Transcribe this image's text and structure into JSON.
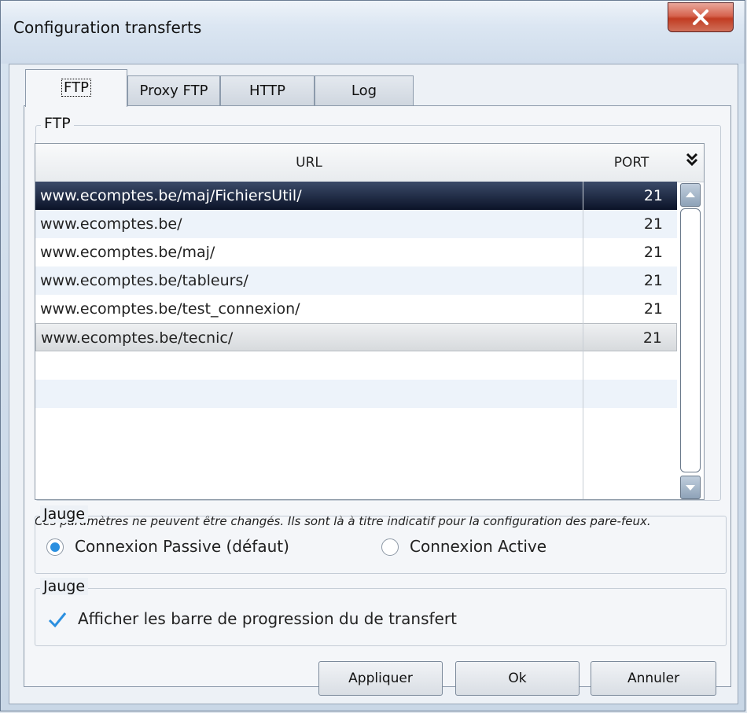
{
  "window": {
    "title": "Configuration transferts"
  },
  "tabs": [
    {
      "label": "FTP",
      "active": true
    },
    {
      "label": "Proxy FTP",
      "active": false
    },
    {
      "label": "HTTP",
      "active": false
    },
    {
      "label": "Log",
      "active": false
    }
  ],
  "ftp_group": {
    "legend": "FTP",
    "columns": {
      "url": "URL",
      "port": "PORT"
    },
    "rows": [
      {
        "url": "www.ecomptes.be/maj/FichiersUtil/",
        "port": "21"
      },
      {
        "url": "www.ecomptes.be/",
        "port": "21"
      },
      {
        "url": "www.ecomptes.be/maj/",
        "port": "21"
      },
      {
        "url": "www.ecomptes.be/tableurs/",
        "port": "21"
      },
      {
        "url": "www.ecomptes.be/test_connexion/",
        "port": "21"
      },
      {
        "url": "www.ecomptes.be/tecnic/",
        "port": "21"
      }
    ],
    "note": "Ces paramètres ne peuvent être changés. Ils sont là à titre indicatif pour la configuration des pare-feux."
  },
  "mode_group": {
    "legend": "Jauge",
    "passive_label": "Connexion Passive (défaut)",
    "active_label": "Connexion Active",
    "selected": "passive"
  },
  "progress_group": {
    "legend": "Jauge",
    "checkbox_label": "Afficher les barre de progression du de transfert",
    "checked": true
  },
  "buttons": {
    "apply": "Appliquer",
    "ok": "Ok",
    "cancel": "Annuler"
  },
  "colors": {
    "selection": "#0b1328",
    "accent": "#2a8fe0",
    "close": "#c13c22"
  }
}
